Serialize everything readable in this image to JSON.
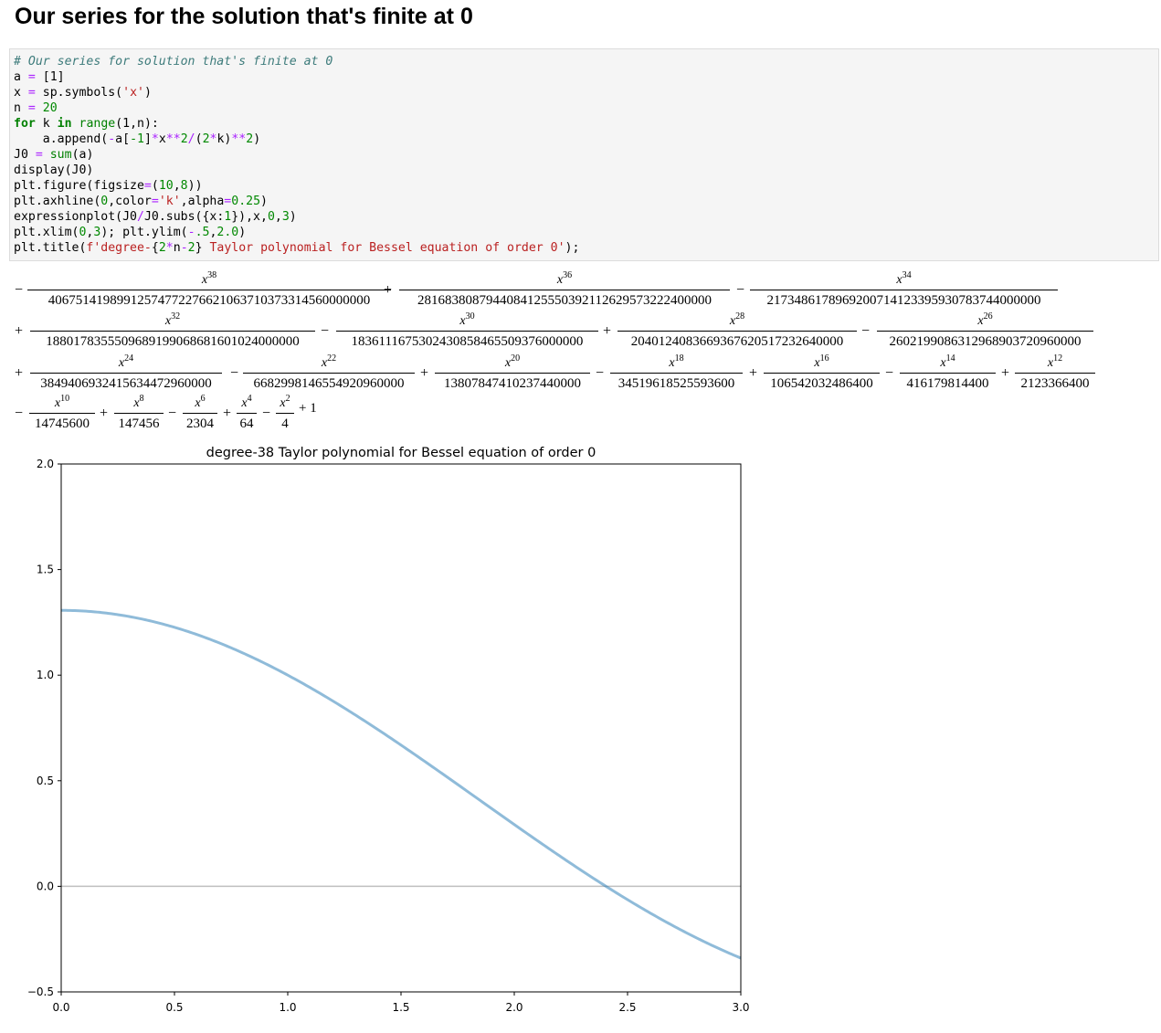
{
  "heading": "Our series for the solution that's finite at 0",
  "code_lines": [
    [
      {
        "t": "# Our series for solution that's finite at 0",
        "c": "cm"
      }
    ],
    [
      {
        "t": "a "
      },
      {
        "t": "=",
        "c": "op"
      },
      {
        "t": " [1]"
      }
    ],
    [
      {
        "t": "x "
      },
      {
        "t": "=",
        "c": "op"
      },
      {
        "t": " sp.symbols("
      },
      {
        "t": "'x'",
        "c": "st"
      },
      {
        "t": ")"
      }
    ],
    [
      {
        "t": "n "
      },
      {
        "t": "=",
        "c": "op"
      },
      {
        "t": " "
      },
      {
        "t": "20",
        "c": "nu"
      }
    ],
    [
      {
        "t": "for",
        "c": "kw"
      },
      {
        "t": " k "
      },
      {
        "t": "in",
        "c": "kw"
      },
      {
        "t": " "
      },
      {
        "t": "range",
        "c": "bi"
      },
      {
        "t": "(1,n):"
      }
    ],
    [
      {
        "t": "    a.append("
      },
      {
        "t": "-",
        "c": "op"
      },
      {
        "t": "a["
      },
      {
        "t": "-1",
        "c": "nu"
      },
      {
        "t": "]"
      },
      {
        "t": "*",
        "c": "op"
      },
      {
        "t": "x"
      },
      {
        "t": "**",
        "c": "op"
      },
      {
        "t": "2",
        "c": "nu"
      },
      {
        "t": "/",
        "c": "op"
      },
      {
        "t": "("
      },
      {
        "t": "2",
        "c": "nu"
      },
      {
        "t": "*",
        "c": "op"
      },
      {
        "t": "k)"
      },
      {
        "t": "**",
        "c": "op"
      },
      {
        "t": "2",
        "c": "nu"
      },
      {
        "t": ")"
      }
    ],
    [
      {
        "t": "J0 "
      },
      {
        "t": "=",
        "c": "op"
      },
      {
        "t": " "
      },
      {
        "t": "sum",
        "c": "bi"
      },
      {
        "t": "(a)"
      }
    ],
    [
      {
        "t": "display(J0)"
      }
    ],
    [
      {
        "t": "plt.figure(figsize"
      },
      {
        "t": "=",
        "c": "op"
      },
      {
        "t": "("
      },
      {
        "t": "10",
        "c": "nu"
      },
      {
        "t": ","
      },
      {
        "t": "8",
        "c": "nu"
      },
      {
        "t": "))"
      }
    ],
    [
      {
        "t": "plt.axhline("
      },
      {
        "t": "0",
        "c": "nu"
      },
      {
        "t": ",color"
      },
      {
        "t": "=",
        "c": "op"
      },
      {
        "t": "'k'",
        "c": "st"
      },
      {
        "t": ",alpha"
      },
      {
        "t": "=",
        "c": "op"
      },
      {
        "t": "0.25",
        "c": "nu"
      },
      {
        "t": ")"
      }
    ],
    [
      {
        "t": "expressionplot(J0"
      },
      {
        "t": "/",
        "c": "op"
      },
      {
        "t": "J0.subs({x:"
      },
      {
        "t": "1",
        "c": "nu"
      },
      {
        "t": "}),x,"
      },
      {
        "t": "0",
        "c": "nu"
      },
      {
        "t": ","
      },
      {
        "t": "3",
        "c": "nu"
      },
      {
        "t": ")"
      }
    ],
    [
      {
        "t": "plt.xlim("
      },
      {
        "t": "0",
        "c": "nu"
      },
      {
        "t": ","
      },
      {
        "t": "3",
        "c": "nu"
      },
      {
        "t": "); plt.ylim("
      },
      {
        "t": "-",
        "c": "op"
      },
      {
        "t": ".5",
        "c": "nu"
      },
      {
        "t": ","
      },
      {
        "t": "2.0",
        "c": "nu"
      },
      {
        "t": ")"
      }
    ],
    [
      {
        "t": "plt.title("
      },
      {
        "t": "f'degree-",
        "c": "st"
      },
      {
        "t": "{"
      },
      {
        "t": "2",
        "c": "nu"
      },
      {
        "t": "*",
        "c": "op"
      },
      {
        "t": "n"
      },
      {
        "t": "-",
        "c": "op"
      },
      {
        "t": "2",
        "c": "nu"
      },
      {
        "t": "}"
      },
      {
        "t": " Taylor polynomial for Bessel equation of order 0'",
        "c": "st"
      },
      {
        "t": ");"
      }
    ]
  ],
  "polynomial_terms": [
    {
      "sign": "−",
      "exp": "38",
      "den": "40675141989912574772276621063710373314560000000"
    },
    {
      "sign": "+",
      "exp": "36",
      "den": "2816838087944084125550392112629573222400000"
    },
    {
      "sign": "−",
      "exp": "34",
      "den": "2173486178969200714123395930783744000000"
    },
    {
      "sign": "+",
      "exp": "32",
      "den": "1880178355509689199068681601024000000"
    },
    {
      "sign": "−",
      "exp": "30",
      "den": "1836111675302430858465509376000000"
    },
    {
      "sign": "+",
      "exp": "28",
      "den": "2040124083669367620517232640000"
    },
    {
      "sign": "−",
      "exp": "26",
      "den": "2602199086312968903720960000"
    },
    {
      "sign": "+",
      "exp": "24",
      "den": "3849406932415634472960000"
    },
    {
      "sign": "−",
      "exp": "22",
      "den": "6682998146554920960000"
    },
    {
      "sign": "+",
      "exp": "20",
      "den": "13807847410237440000"
    },
    {
      "sign": "−",
      "exp": "18",
      "den": "34519618525593600"
    },
    {
      "sign": "+",
      "exp": "16",
      "den": "106542032486400"
    },
    {
      "sign": "−",
      "exp": "14",
      "den": "416179814400"
    },
    {
      "sign": "+",
      "exp": "12",
      "den": "2123366400"
    },
    {
      "sign": "−",
      "exp": "10",
      "den": "14745600"
    },
    {
      "sign": "+",
      "exp": "8",
      "den": "147456"
    },
    {
      "sign": "−",
      "exp": "6",
      "den": "2304"
    },
    {
      "sign": "+",
      "exp": "4",
      "den": "64"
    },
    {
      "sign": "−",
      "exp": "2",
      "den": "4"
    }
  ],
  "polynomial_tail": "+ 1",
  "chart_data": {
    "type": "line",
    "title": "degree-38 Taylor polynomial for Bessel equation of order 0",
    "xlabel": "",
    "ylabel": "",
    "xlim": [
      0,
      3
    ],
    "ylim": [
      -0.5,
      2.0
    ],
    "xticks": [
      "0.0",
      "0.5",
      "1.0",
      "1.5",
      "2.0",
      "2.5",
      "3.0"
    ],
    "yticks": [
      "−0.5",
      "0.0",
      "0.5",
      "1.0",
      "1.5",
      "2.0"
    ],
    "xtick_values": [
      0,
      0.5,
      1.0,
      1.5,
      2.0,
      2.5,
      3.0
    ],
    "ytick_values": [
      -0.5,
      0,
      0.5,
      1.0,
      1.5,
      2.0
    ],
    "grid": false,
    "hline": {
      "y": 0,
      "color": "#000000",
      "alpha": 0.25
    },
    "series": [
      {
        "function": "J0(x)/J0(1)",
        "color": "#1f77b4",
        "alpha": 0.5
      }
    ]
  }
}
